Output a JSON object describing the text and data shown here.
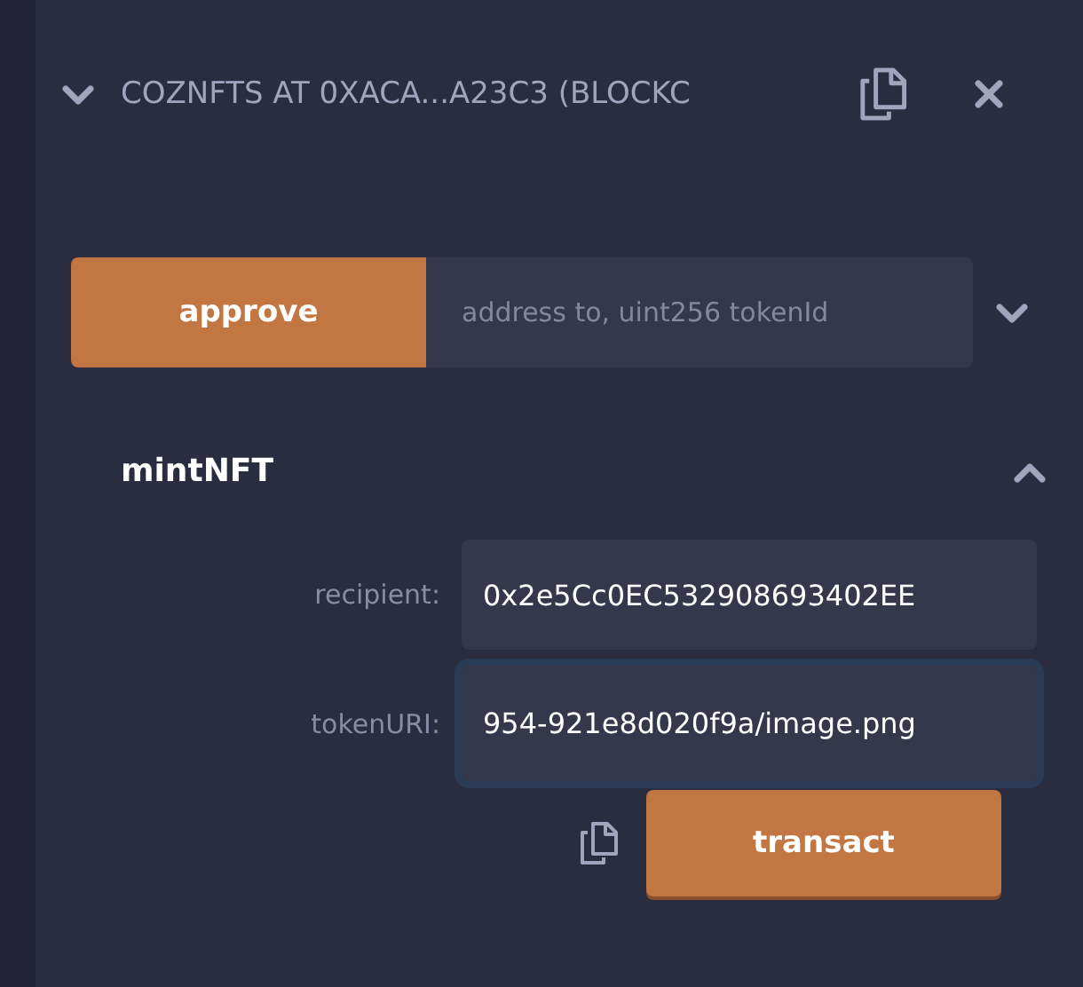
{
  "instance": {
    "title": "COZNFTS AT 0XACA...A23C3 (BLOCKC",
    "expanded": true
  },
  "functions": [
    {
      "name": "approve",
      "expanded": false,
      "placeholder": "address to, uint256 tokenId"
    },
    {
      "name": "mintNFT",
      "expanded": true,
      "params": [
        {
          "label": "recipient:",
          "value": "0x2e5Cc0EC532908693402EE",
          "focused": false
        },
        {
          "label": "tokenURI:",
          "value": "954-921e8d020f9a/image.png",
          "focused": true
        }
      ],
      "action": "transact"
    }
  ]
}
